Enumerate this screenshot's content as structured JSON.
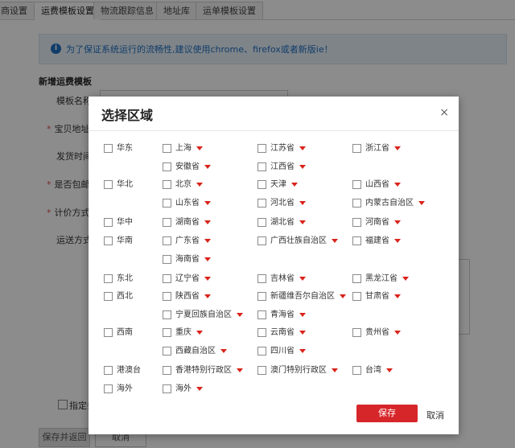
{
  "tabs": [
    "商设置",
    "运费模板设置",
    "物流跟踪信息",
    "地址库",
    "运单模板设置"
  ],
  "notice": "为了保证系统运行的流畅性,建议使用chrome、firefox或者新版ie！",
  "form": {
    "section_title": "新增运费模板",
    "labels": [
      "模板名称",
      "宝贝地址",
      "发货时间",
      "是否包邮",
      "计价方式",
      "运送方式"
    ],
    "specify_label": "指定条",
    "save_return": "保存并返回",
    "cancel": "取消"
  },
  "modal": {
    "title": "选择区域",
    "close": "×",
    "save": "保存",
    "cancel": "取消",
    "regions": [
      {
        "name": "华东",
        "provinces": [
          "上海",
          "江苏省",
          "浙江省",
          "安徽省",
          "江西省"
        ]
      },
      {
        "name": "华北",
        "provinces": [
          "北京",
          "天津",
          "山西省",
          "山东省",
          "河北省",
          "内蒙古自治区"
        ]
      },
      {
        "name": "华中",
        "provinces": [
          "湖南省",
          "湖北省",
          "河南省"
        ]
      },
      {
        "name": "华南",
        "provinces": [
          "广东省",
          "广西壮族自治区",
          "福建省",
          "海南省"
        ]
      },
      {
        "name": "东北",
        "provinces": [
          "辽宁省",
          "吉林省",
          "黑龙江省"
        ]
      },
      {
        "name": "西北",
        "provinces": [
          "陕西省",
          "新疆维吾尔自治区",
          "甘肃省",
          "宁夏回族自治区",
          "青海省"
        ]
      },
      {
        "name": "西南",
        "provinces": [
          "重庆",
          "云南省",
          "贵州省",
          "西藏自治区",
          "四川省"
        ]
      },
      {
        "name": "港澳台",
        "provinces": [
          "香港特别行政区",
          "澳门特别行政区",
          "台湾"
        ]
      },
      {
        "name": "海外",
        "provinces": [
          "海外"
        ]
      }
    ]
  }
}
